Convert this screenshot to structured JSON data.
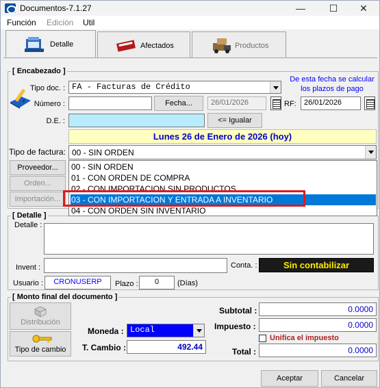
{
  "window": {
    "title": "Documentos-7.1.27",
    "minimize": "—",
    "maximize": "☐",
    "close": "✕"
  },
  "menu": {
    "items": [
      "Función",
      "Edición",
      "Util"
    ]
  },
  "tabs": [
    "Detalle",
    "Afectados",
    "Productos"
  ],
  "encabezado": {
    "group_title": "[ Encabezado ]",
    "note": "De esta fecha se calcular los plazos de pago",
    "tipo_doc_label": "Tipo doc. :",
    "tipo_doc_value": "FA - Facturas de Crédito",
    "numero_label": "Número :",
    "numero_value": "",
    "fecha_button": "Fecha...",
    "fecha_value": "26/01/2026",
    "rf_label": "RF:",
    "rf_value": "26/01/2026",
    "de_label": "D.E. :",
    "de_value": "",
    "igualar_button": "<= Igualar",
    "date_banner": "Lunes 26 de Enero de 2026 (hoy)",
    "tipo_factura_label": "Tipo de factura:",
    "tipo_factura_value": "00 - SIN ORDEN",
    "tipo_factura_options": [
      "00 - SIN ORDEN",
      "01 - CON ORDEN DE COMPRA",
      "02 - CON IMPORTACION SIN PRODUCTOS",
      "03 - CON IMPORTACION Y ENTRADA A INVENTARIO",
      "04 - CON ORDEN SIN INVENTARIO"
    ],
    "selected_option_index": 3,
    "proveedor_button": "Proveedor...",
    "orden_button": "Orden...",
    "importacion_button": "Importación..."
  },
  "detalle": {
    "group_title": "[ Detalle ]",
    "detalle_label": "Detalle :",
    "invent_label": "Invent :",
    "conta_label": "Conta. :",
    "conta_status": "Sin contabilizar",
    "usuario_label": "Usuario :",
    "usuario_value": "CRONUSERP",
    "plazo_label": "Plazo :",
    "plazo_value": "0",
    "dias_label": "(Días)"
  },
  "monto": {
    "group_title": "[ Monto final del documento ]",
    "distribucion_button": "Distribución",
    "tipo_cambio_button": "Tipo de cambio",
    "moneda_label": "Moneda :",
    "moneda_value": "Local",
    "tcambio_label": "T. Cambio :",
    "tcambio_value": "492.44",
    "subtotal_label": "Subtotal :",
    "subtotal_value": "0.0000",
    "impuesto_label": "Impuesto :",
    "impuesto_value": "0.0000",
    "unifica_label": "Unifica el impuesto",
    "total_label": "Total :",
    "total_value": "0.0000"
  },
  "footer": {
    "aceptar": "Aceptar",
    "cancelar": "Cancelar"
  },
  "colors": {
    "accent_blue": "#0000ff",
    "selection": "#0078d7",
    "banner": "#ffffc0",
    "cyan_field": "#b8ecfd",
    "status_bg": "#1a1a1a",
    "status_text": "#ffee00",
    "highlight_red": "#e0191b",
    "dark_red": "#aa2222"
  }
}
